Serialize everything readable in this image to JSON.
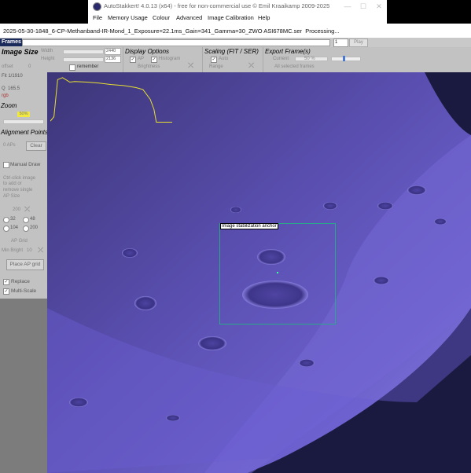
{
  "window": {
    "title": "AutoStakkert! 4.0.13 (x64) - free for non-commercial use © Emil Kraaikamp 2009-2025",
    "controls": [
      "—",
      "☐",
      "✕"
    ]
  },
  "menu": [
    "File",
    "Memory Usage",
    "Colour",
    "Advanced",
    "Image Calibration",
    "Help"
  ],
  "file": {
    "name": "2025-05-30-1848_6-CP-Methanband-IR-Mond_1_Exposure=22.1ms_Gain=341_Gamma=30_ZWO ASI678MC.ser",
    "status": "Processing..."
  },
  "frames": {
    "label": "Frames",
    "current": "1",
    "play_label": "Play"
  },
  "image_size": {
    "title": "Image Size",
    "width_label": "Width",
    "width_value": "2440",
    "height_label": "Height",
    "height_value": "2136",
    "remember_label": "remember",
    "offset_label": "offset",
    "offset_value": "0"
  },
  "display_options": {
    "title": "Display Options",
    "ap_label": "AP",
    "histogram_label": "Histogram",
    "brightness_label": "Brightness"
  },
  "scaling": {
    "title": "Scaling (FIT / SER)",
    "auto_label": "Auto",
    "range_label": "Range"
  },
  "export": {
    "title": "Export Frame(s)",
    "current_label": "Current",
    "percent": "50 %",
    "all_label": "All selected frames"
  },
  "left": {
    "fit_label": "Fit",
    "fit_value": "1/1910",
    "quality_label": "Q",
    "quality_value": "165.5",
    "rgb_label": "rgb",
    "zoom_title": "Zoom",
    "zoom_value": "50%",
    "ap_title": "Alignment Points",
    "ap_count": "0 APs",
    "clear_label": "Clear",
    "manual_draw_label": "Manual Draw",
    "hint_lines": [
      "Ctrl-click image",
      "to add or",
      "remove single",
      "AP Size"
    ],
    "ap_size_value": "200",
    "ap_sizes": [
      "32",
      "48",
      "104",
      "200"
    ],
    "min_bright_label": "Min Bright",
    "min_bright_value": "10",
    "grid_label": "AP Grid",
    "place_btn_label": "Place AP grid",
    "replace_label": "Replace",
    "multiscale_label": "Multi-Scale"
  },
  "anchor": {
    "label": "Image stabilization anchor"
  },
  "colors": {
    "accent": "#1a2a5a",
    "panel_bg": "#c2c2c2",
    "graph_line": "#e8e030",
    "anchor_border": "#2aa88a",
    "moon_purple": "#6a5fc8"
  },
  "graph_curve": [
    [
      0.0,
      0.06
    ],
    [
      0.03,
      0.15
    ],
    [
      0.06,
      0.9
    ],
    [
      0.1,
      0.94
    ],
    [
      0.16,
      0.85
    ],
    [
      0.2,
      0.86
    ],
    [
      0.3,
      0.85
    ],
    [
      0.4,
      0.83
    ],
    [
      0.5,
      0.8
    ],
    [
      0.6,
      0.78
    ],
    [
      0.7,
      0.74
    ],
    [
      0.76,
      0.7
    ],
    [
      0.82,
      0.5
    ],
    [
      0.85,
      0.3
    ],
    [
      0.87,
      0.04
    ],
    [
      1.0,
      0.04
    ]
  ]
}
